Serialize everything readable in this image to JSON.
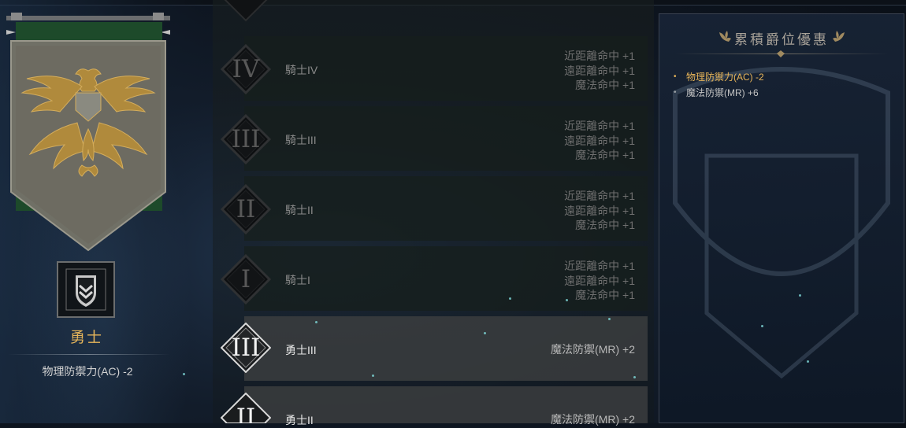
{
  "left_panel": {
    "banner": "eagle-crest-banner",
    "emblem": "chevron-shield-emblem",
    "rank_name": "勇士",
    "rank_bonus": "物理防禦力(AC) -2"
  },
  "ranks": [
    {
      "numeral": "IV",
      "label": "騎士IV",
      "bonuses": [
        "近距離命中 +1",
        "遠距離命中 +1",
        "魔法命中 +1"
      ],
      "active": false
    },
    {
      "numeral": "III",
      "label": "騎士III",
      "bonuses": [
        "近距離命中 +1",
        "遠距離命中 +1",
        "魔法命中 +1"
      ],
      "active": false
    },
    {
      "numeral": "II",
      "label": "騎士II",
      "bonuses": [
        "近距離命中 +1",
        "遠距離命中 +1",
        "魔法命中 +1"
      ],
      "active": false
    },
    {
      "numeral": "I",
      "label": "騎士I",
      "bonuses": [
        "近距離命中 +1",
        "遠距離命中 +1",
        "魔法命中 +1"
      ],
      "active": false
    },
    {
      "numeral": "III",
      "label": "勇士III",
      "bonuses": [
        "魔法防禦(MR) +2"
      ],
      "active": true
    },
    {
      "numeral": "II",
      "label": "勇士II",
      "bonuses": [
        "魔法防禦(MR) +2"
      ],
      "active": true
    }
  ],
  "cumulative_panel": {
    "title": "累積爵位優惠",
    "bonuses": [
      "物理防禦力(AC) -2",
      "魔法防禦(MR) +6"
    ]
  },
  "colors": {
    "gold_text": "#e6b55a",
    "active_numeral": "#f2f2f2",
    "inactive_numeral": "#585858"
  }
}
